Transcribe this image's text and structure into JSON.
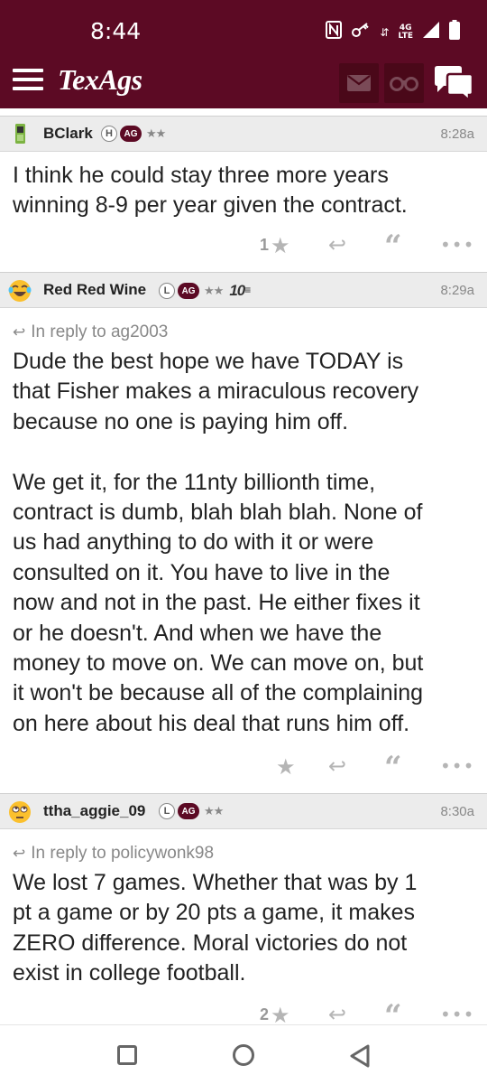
{
  "status_bar": {
    "time": "8:44",
    "network": "4G",
    "network_sub": "LTE"
  },
  "app": {
    "logo": "TexAgs",
    "brand_color": "#5c0a24"
  },
  "posts": [
    {
      "username": "BClark",
      "badge_letter": "H",
      "badge_ag": "AG",
      "stars": "★★",
      "time": "8:28a",
      "avatar_icon": "phone-icon",
      "reply_to": "",
      "body": "I think he could stay three more years\nwinning 8-9 per year given the contract.",
      "star_count": "1"
    },
    {
      "username": "Red Red Wine",
      "badge_letter": "L",
      "badge_ag": "AG",
      "stars": "★★",
      "ten_badge": "10",
      "time": "8:29a",
      "avatar_icon": "laughing-emoji-icon",
      "reply_to": "In reply to ag2003",
      "body": "Dude the best hope we have TODAY is\nthat Fisher makes a miraculous recovery\nbecause no one is paying him off.\n\nWe get it, for the 11nty billionth time,\ncontract is dumb, blah blah blah. None of\nus had anything to do with it or were\nconsulted on it. You have to live in the\nnow and not in the past. He either fixes it\nor he doesn't. And when we have the\nmoney to move on. We can move on, but\nit won't be because all of the complaining\non here about his deal that runs him off.",
      "star_count": ""
    },
    {
      "username": "ttha_aggie_09",
      "badge_letter": "L",
      "badge_ag": "AG",
      "stars": "★★",
      "time": "8:30a",
      "avatar_icon": "rolling-eyes-emoji-icon",
      "reply_to": "In reply to policywonk98",
      "body": "We lost 7 games. Whether that was by 1\npt a game or by 20 pts a game, it makes\nZERO difference. Moral victories do not\nexist in college football.",
      "star_count": "2"
    }
  ]
}
